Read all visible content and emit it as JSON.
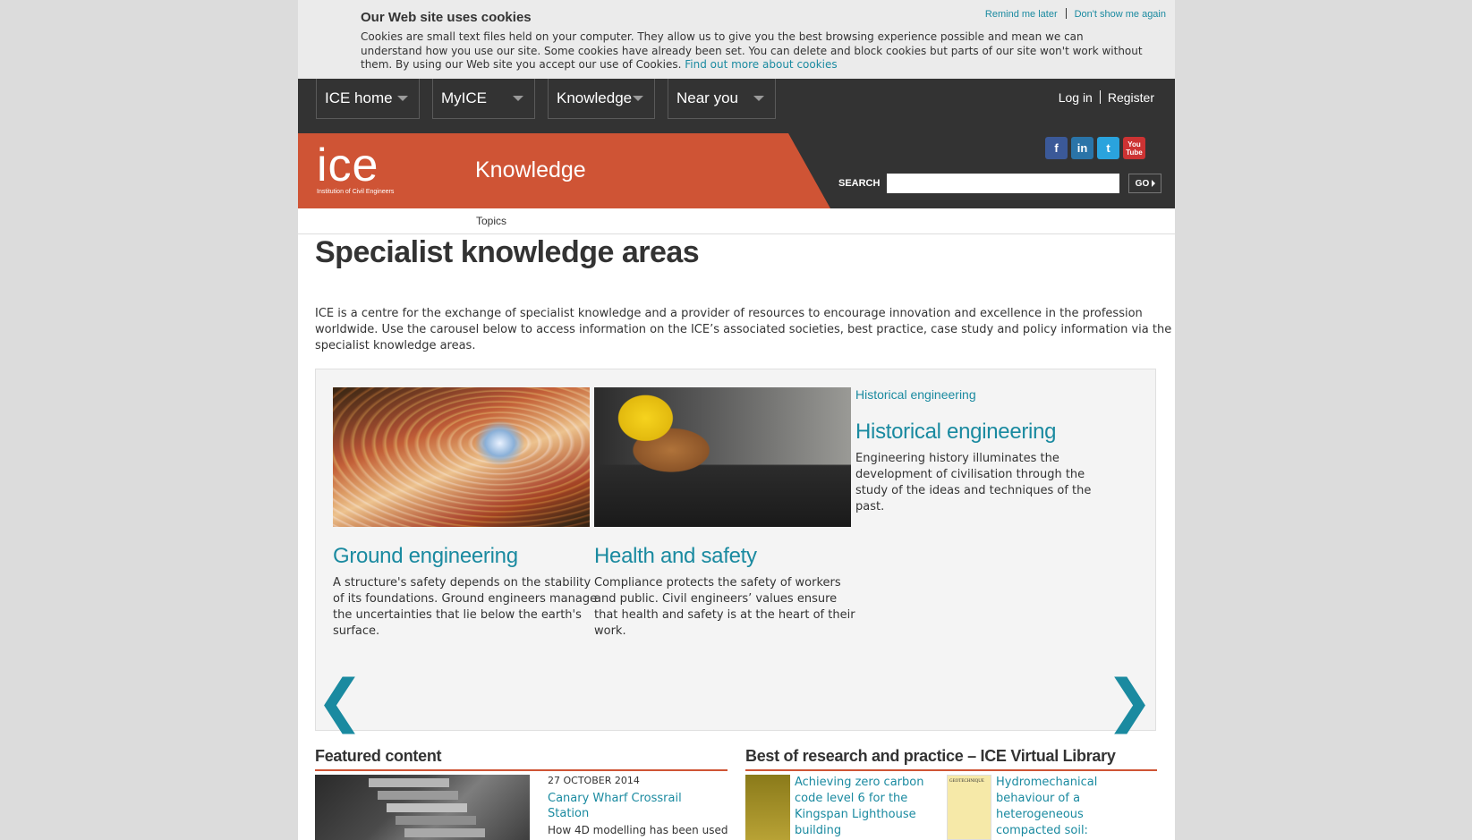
{
  "cookie": {
    "title": "Our Web site uses cookies",
    "text": "Cookies are small text files held on your computer. They allow us to give you the best browsing experience possible and mean we can understand how you use our site. Some cookies have already been set. You can delete and block cookies but parts of our site won't work without them. By using our Web site you accept our use of Cookies.",
    "link": "Find out more about cookies",
    "remind": "Remind me later",
    "dont_show": "Don't show me again"
  },
  "nav": {
    "items": [
      {
        "label": "ICE home"
      },
      {
        "label": "MyICE"
      },
      {
        "label": "Knowledge"
      },
      {
        "label": "Near you"
      }
    ],
    "login": "Log in",
    "register": "Register"
  },
  "brand": {
    "logo_text": "ice",
    "logo_sub": "Institution of Civil Engineers",
    "section": "Knowledge",
    "accent": "#cf5435",
    "link_color": "#1a8aa0",
    "header_bg": "#333333"
  },
  "social": {
    "facebook": "f",
    "linkedin": "in",
    "twitter": "t",
    "youtube": "You Tube"
  },
  "search": {
    "label": "SEARCH",
    "placeholder": "",
    "go": "GO"
  },
  "subnav": {
    "topics": "Topics"
  },
  "page": {
    "title": "Specialist knowledge areas",
    "intro": "ICE is a centre for the exchange of specialist knowledge and a provider of resources to encourage innovation and excellence in the profession worldwide. Use the carousel below to access information on the ICE’s associated societies, best practice, case study and policy information via the specialist knowledge areas."
  },
  "carousel": {
    "cards": [
      {
        "title": "Ground engineering",
        "text": "A structure's safety depends on the stability of its foundations. Ground engineers manage the uncertainties that lie below the earth's surface."
      },
      {
        "title": "Health and safety",
        "text": "Compliance protects the safety of workers and public. Civil engineers’ values ensure that health and safety is at the heart of their work."
      },
      {
        "category": "Historical engineering",
        "title": "Historical engineering",
        "text": "Engineering history illuminates the development of civilisation through the study of the ideas and techniques of the past."
      }
    ],
    "prev": "❮",
    "next": "❯"
  },
  "featured": {
    "heading": "Featured content",
    "date": "27 OCTOBER 2014",
    "title": "Canary Wharf Crossrail Station",
    "desc": "How 4D modelling has been used"
  },
  "library": {
    "heading": "Best of research and practice – ICE Virtual Library",
    "items": [
      {
        "title": "Achieving zero carbon code level 6 for the Kingspan Lighthouse building"
      },
      {
        "title": "Hydromechanical behaviour of a heterogeneous compacted soil:"
      }
    ]
  }
}
